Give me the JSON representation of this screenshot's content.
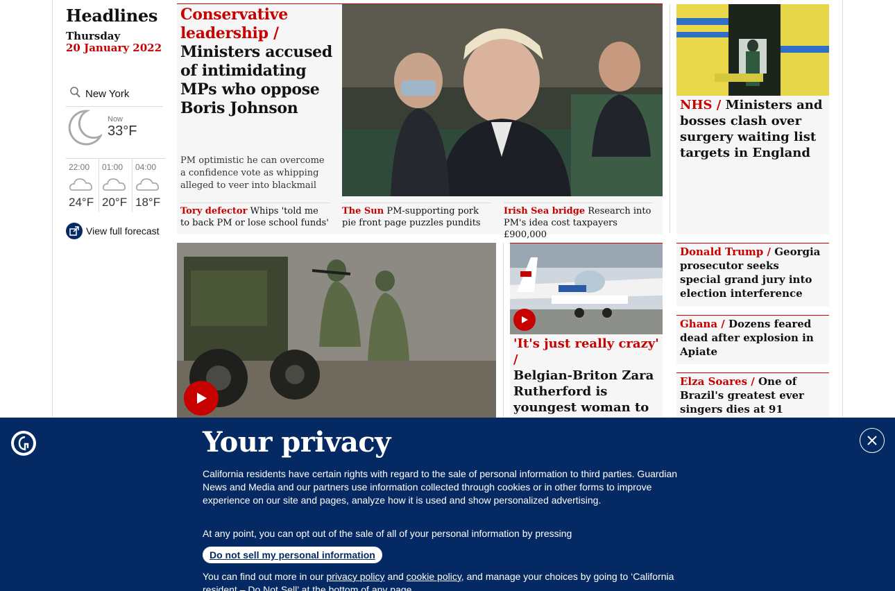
{
  "sidebar": {
    "title": "Headlines",
    "day": "Thursday",
    "date": "20 January 2022"
  },
  "weather": {
    "city": "New York",
    "now_label": "Now",
    "now_temp": "33°F",
    "forecast": [
      {
        "time": "22:00",
        "temp": "24°F"
      },
      {
        "time": "01:00",
        "temp": "20°F"
      },
      {
        "time": "04:00",
        "temp": "18°F"
      }
    ],
    "full_forecast_label": "View full forecast"
  },
  "main_story": {
    "kicker": "Conservative leadership /",
    "headline": "Ministers accused of intimidating MPs who oppose Boris Johnson",
    "standfirst": "PM optimistic he can overcome a confidence vote as whipping alleged to veer into blackmail",
    "sublinks": [
      {
        "kicker": "Tory defector",
        "text": "Whips 'told me to back PM or lose school funds'"
      },
      {
        "kicker": "The Sun",
        "text": "PM-supporting pork pie front page puzzles pundits"
      },
      {
        "kicker": "Irish Sea bridge",
        "text": "Research into PM's idea cost taxpayers £900,000"
      }
    ]
  },
  "nhs_story": {
    "kicker": "NHS /",
    "headline": "Ministers and bosses clash over surgery waiting list targets in England"
  },
  "plane_story": {
    "kicker": "'It's just really crazy' /",
    "headline": "Belgian-Briton Zara Rutherford is youngest woman to fly solo around world"
  },
  "side_stories": [
    {
      "kicker": "Donald Trump /",
      "headline": "Georgia prosecutor seeks special grand jury into election interference"
    },
    {
      "kicker": "Ghana /",
      "headline": "Dozens feared dead after explosion in Apiate"
    },
    {
      "kicker": "Elza Soares /",
      "headline": "One of Brazil's greatest ever singers dies at 91"
    }
  ],
  "privacy": {
    "title": "Your privacy",
    "body": "California residents have certain rights with regard to the sale of personal information to third parties. Guardian News and Media and our partners use information collected through cookies or in other forms to improve experience on our site and pages, analyze how it is used and show personalized advertising.",
    "opt_out_text": "At any point, you can opt out of the sale of all of your personal information by pressing",
    "button_label": "Do not sell my personal information",
    "more_prefix": "You can find out more in our",
    "privacy_link": "privacy policy",
    "and_text": "and",
    "cookie_link": "cookie policy",
    "more_suffix": ", and manage your choices by going to ‘California resident – Do Not Sell’ at the bottom of any page."
  },
  "colors": {
    "brand_red": "#c70000",
    "brand_navy": "#052962",
    "card_bg": "#f6f6f6"
  },
  "icons": [
    "search-icon",
    "moon-icon",
    "cloud-icon",
    "external-link-icon",
    "play-icon",
    "guardian-logo-icon",
    "close-icon"
  ]
}
